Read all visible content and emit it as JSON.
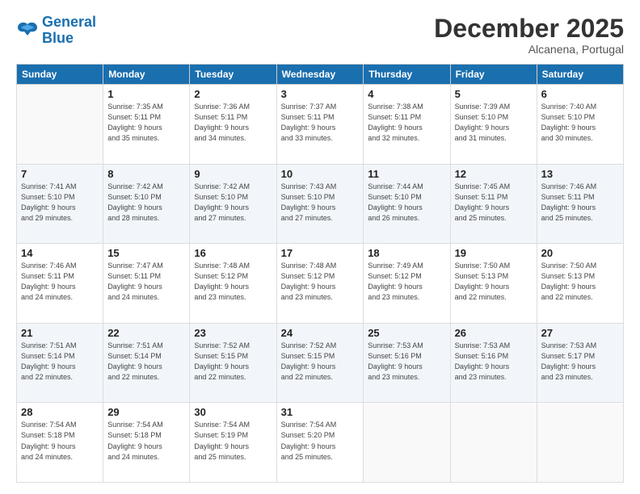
{
  "logo": {
    "line1": "General",
    "line2": "Blue"
  },
  "title": "December 2025",
  "subtitle": "Alcanena, Portugal",
  "header_days": [
    "Sunday",
    "Monday",
    "Tuesday",
    "Wednesday",
    "Thursday",
    "Friday",
    "Saturday"
  ],
  "weeks": [
    [
      {
        "day": "",
        "info": ""
      },
      {
        "day": "1",
        "info": "Sunrise: 7:35 AM\nSunset: 5:11 PM\nDaylight: 9 hours\nand 35 minutes."
      },
      {
        "day": "2",
        "info": "Sunrise: 7:36 AM\nSunset: 5:11 PM\nDaylight: 9 hours\nand 34 minutes."
      },
      {
        "day": "3",
        "info": "Sunrise: 7:37 AM\nSunset: 5:11 PM\nDaylight: 9 hours\nand 33 minutes."
      },
      {
        "day": "4",
        "info": "Sunrise: 7:38 AM\nSunset: 5:11 PM\nDaylight: 9 hours\nand 32 minutes."
      },
      {
        "day": "5",
        "info": "Sunrise: 7:39 AM\nSunset: 5:10 PM\nDaylight: 9 hours\nand 31 minutes."
      },
      {
        "day": "6",
        "info": "Sunrise: 7:40 AM\nSunset: 5:10 PM\nDaylight: 9 hours\nand 30 minutes."
      }
    ],
    [
      {
        "day": "7",
        "info": "Sunrise: 7:41 AM\nSunset: 5:10 PM\nDaylight: 9 hours\nand 29 minutes."
      },
      {
        "day": "8",
        "info": "Sunrise: 7:42 AM\nSunset: 5:10 PM\nDaylight: 9 hours\nand 28 minutes."
      },
      {
        "day": "9",
        "info": "Sunrise: 7:42 AM\nSunset: 5:10 PM\nDaylight: 9 hours\nand 27 minutes."
      },
      {
        "day": "10",
        "info": "Sunrise: 7:43 AM\nSunset: 5:10 PM\nDaylight: 9 hours\nand 27 minutes."
      },
      {
        "day": "11",
        "info": "Sunrise: 7:44 AM\nSunset: 5:10 PM\nDaylight: 9 hours\nand 26 minutes."
      },
      {
        "day": "12",
        "info": "Sunrise: 7:45 AM\nSunset: 5:11 PM\nDaylight: 9 hours\nand 25 minutes."
      },
      {
        "day": "13",
        "info": "Sunrise: 7:46 AM\nSunset: 5:11 PM\nDaylight: 9 hours\nand 25 minutes."
      }
    ],
    [
      {
        "day": "14",
        "info": "Sunrise: 7:46 AM\nSunset: 5:11 PM\nDaylight: 9 hours\nand 24 minutes."
      },
      {
        "day": "15",
        "info": "Sunrise: 7:47 AM\nSunset: 5:11 PM\nDaylight: 9 hours\nand 24 minutes."
      },
      {
        "day": "16",
        "info": "Sunrise: 7:48 AM\nSunset: 5:12 PM\nDaylight: 9 hours\nand 23 minutes."
      },
      {
        "day": "17",
        "info": "Sunrise: 7:48 AM\nSunset: 5:12 PM\nDaylight: 9 hours\nand 23 minutes."
      },
      {
        "day": "18",
        "info": "Sunrise: 7:49 AM\nSunset: 5:12 PM\nDaylight: 9 hours\nand 23 minutes."
      },
      {
        "day": "19",
        "info": "Sunrise: 7:50 AM\nSunset: 5:13 PM\nDaylight: 9 hours\nand 22 minutes."
      },
      {
        "day": "20",
        "info": "Sunrise: 7:50 AM\nSunset: 5:13 PM\nDaylight: 9 hours\nand 22 minutes."
      }
    ],
    [
      {
        "day": "21",
        "info": "Sunrise: 7:51 AM\nSunset: 5:14 PM\nDaylight: 9 hours\nand 22 minutes."
      },
      {
        "day": "22",
        "info": "Sunrise: 7:51 AM\nSunset: 5:14 PM\nDaylight: 9 hours\nand 22 minutes."
      },
      {
        "day": "23",
        "info": "Sunrise: 7:52 AM\nSunset: 5:15 PM\nDaylight: 9 hours\nand 22 minutes."
      },
      {
        "day": "24",
        "info": "Sunrise: 7:52 AM\nSunset: 5:15 PM\nDaylight: 9 hours\nand 22 minutes."
      },
      {
        "day": "25",
        "info": "Sunrise: 7:53 AM\nSunset: 5:16 PM\nDaylight: 9 hours\nand 23 minutes."
      },
      {
        "day": "26",
        "info": "Sunrise: 7:53 AM\nSunset: 5:16 PM\nDaylight: 9 hours\nand 23 minutes."
      },
      {
        "day": "27",
        "info": "Sunrise: 7:53 AM\nSunset: 5:17 PM\nDaylight: 9 hours\nand 23 minutes."
      }
    ],
    [
      {
        "day": "28",
        "info": "Sunrise: 7:54 AM\nSunset: 5:18 PM\nDaylight: 9 hours\nand 24 minutes."
      },
      {
        "day": "29",
        "info": "Sunrise: 7:54 AM\nSunset: 5:18 PM\nDaylight: 9 hours\nand 24 minutes."
      },
      {
        "day": "30",
        "info": "Sunrise: 7:54 AM\nSunset: 5:19 PM\nDaylight: 9 hours\nand 25 minutes."
      },
      {
        "day": "31",
        "info": "Sunrise: 7:54 AM\nSunset: 5:20 PM\nDaylight: 9 hours\nand 25 minutes."
      },
      {
        "day": "",
        "info": ""
      },
      {
        "day": "",
        "info": ""
      },
      {
        "day": "",
        "info": ""
      }
    ]
  ]
}
